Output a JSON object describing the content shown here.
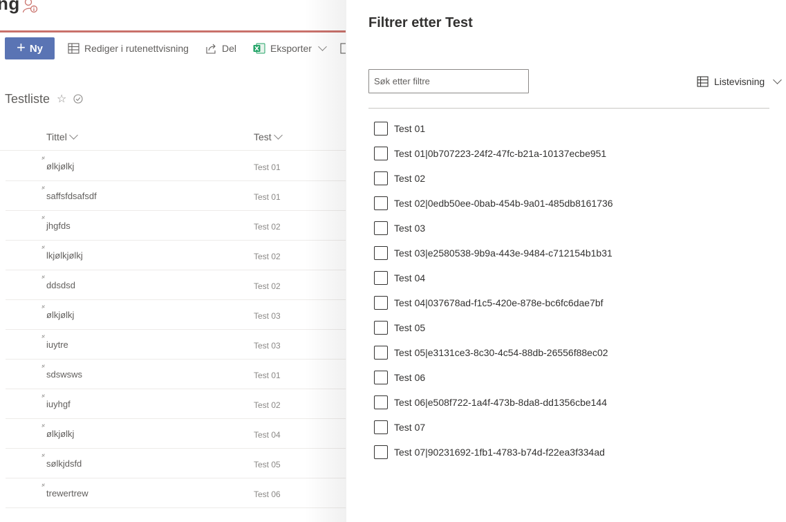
{
  "site": {
    "title_fragment": "ng"
  },
  "commandbar": {
    "new_label": "Ny",
    "grid_edit_label": "Rediger i rutenettvisning",
    "share_label": "Del",
    "export_label": "Eksporter"
  },
  "list": {
    "title": "Testliste",
    "columns": {
      "title": "Tittel",
      "test": "Test"
    },
    "rows": [
      {
        "title": "ølkjølkj",
        "test": "Test 01"
      },
      {
        "title": "saffsfdsafsdf",
        "test": "Test 01"
      },
      {
        "title": "jhgfds",
        "test": "Test 02"
      },
      {
        "title": "lkjølkjølkj",
        "test": "Test 02"
      },
      {
        "title": "ddsdsd",
        "test": "Test 02"
      },
      {
        "title": "ølkjølkj",
        "test": "Test 03"
      },
      {
        "title": "iuytre",
        "test": "Test 03"
      },
      {
        "title": "sdswsws",
        "test": "Test 01"
      },
      {
        "title": "iuyhgf",
        "test": "Test 02"
      },
      {
        "title": "ølkjølkj",
        "test": "Test 04"
      },
      {
        "title": "sølkjdsfd",
        "test": "Test 05"
      },
      {
        "title": "trewertrew",
        "test": "Test 06"
      }
    ]
  },
  "filter_panel": {
    "title": "Filtrer etter Test",
    "search_placeholder": "Søk etter filtre",
    "view_label": "Listevisning",
    "options": [
      "Test 01",
      "Test 01|0b707223-24f2-47fc-b21a-10137ecbe951",
      "Test 02",
      "Test 02|0edb50ee-0bab-454b-9a01-485db8161736",
      "Test 03",
      "Test 03|e2580538-9b9a-443e-9484-c712154b1b31",
      "Test 04",
      "Test 04|037678ad-f1c5-420e-878e-bc6fc6dae7bf",
      "Test 05",
      "Test 05|e3131ce3-8c30-4c54-88db-26556f88ec02",
      "Test 06",
      "Test 06|e508f722-1a4f-473b-8da8-dd1356cbe144",
      "Test 07",
      "Test 07|90231692-1fb1-4783-b74d-f22ea3f334ad"
    ]
  },
  "colors": {
    "accent": "#5a74b4",
    "brand_line": "#c9716b",
    "excel": "#21a366"
  },
  "icons": [
    "user-info-icon",
    "plus-icon",
    "grid-icon",
    "share-icon",
    "excel-icon",
    "star-icon",
    "check-circle-icon",
    "chevron-down-icon",
    "new-item-icon",
    "list-view-icon"
  ]
}
